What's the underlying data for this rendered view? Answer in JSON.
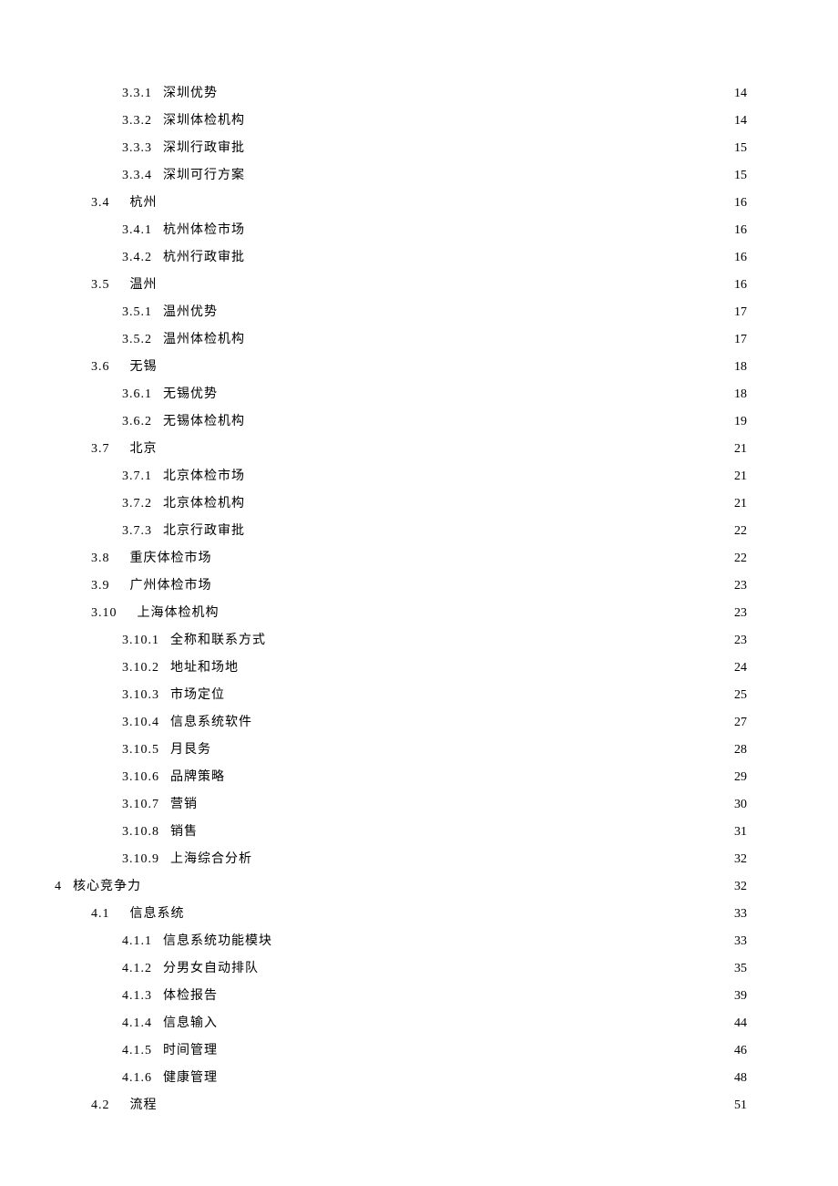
{
  "toc": [
    {
      "indent": 3,
      "num": "3.3.1",
      "title": "深圳优势",
      "page": "14"
    },
    {
      "indent": 3,
      "num": "3.3.2",
      "title": "深圳体检机构",
      "page": "14"
    },
    {
      "indent": 3,
      "num": "3.3.3",
      "title": "深圳行政审批",
      "page": "15"
    },
    {
      "indent": 3,
      "num": "3.3.4",
      "title": "深圳可行方案",
      "page": "15"
    },
    {
      "indent": 2,
      "num": "3.4",
      "title": "杭州",
      "page": "16"
    },
    {
      "indent": 3,
      "num": "3.4.1",
      "title": "杭州体检市场",
      "page": "16"
    },
    {
      "indent": 3,
      "num": "3.4.2",
      "title": "杭州行政审批",
      "page": "16"
    },
    {
      "indent": 2,
      "num": "3.5",
      "title": "温州",
      "page": "16"
    },
    {
      "indent": 3,
      "num": "3.5.1",
      "title": "温州优势",
      "page": "17"
    },
    {
      "indent": 3,
      "num": "3.5.2",
      "title": "温州体检机构",
      "page": "17"
    },
    {
      "indent": 2,
      "num": "3.6",
      "title": "无锡",
      "page": "18"
    },
    {
      "indent": 3,
      "num": "3.6.1",
      "title": "无锡优势",
      "page": "18"
    },
    {
      "indent": 3,
      "num": "3.6.2",
      "title": "无锡体检机构",
      "page": "19"
    },
    {
      "indent": 2,
      "num": "3.7",
      "title": "北京",
      "page": "21"
    },
    {
      "indent": 3,
      "num": "3.7.1",
      "title": "北京体检市场",
      "page": "21"
    },
    {
      "indent": 3,
      "num": "3.7.2",
      "title": "北京体检机构",
      "page": "21"
    },
    {
      "indent": 3,
      "num": "3.7.3",
      "title": "北京行政审批",
      "page": "22"
    },
    {
      "indent": 2,
      "num": "3.8",
      "title": "重庆体检市场",
      "page": "22"
    },
    {
      "indent": 2,
      "num": "3.9",
      "title": "广州体检市场",
      "page": "23"
    },
    {
      "indent": 2,
      "num": "3.10",
      "title": "上海体检机构",
      "page": "23"
    },
    {
      "indent": 3,
      "num": "3.10.1",
      "title": "全称和联系方式",
      "page": "23"
    },
    {
      "indent": 3,
      "num": "3.10.2",
      "title": "地址和场地",
      "page": "24"
    },
    {
      "indent": 3,
      "num": "3.10.3",
      "title": "市场定位",
      "page": "25"
    },
    {
      "indent": 3,
      "num": "3.10.4",
      "title": "信息系统软件",
      "page": "27"
    },
    {
      "indent": 3,
      "num": "3.10.5",
      "title": "月艮务",
      "page": "28"
    },
    {
      "indent": 3,
      "num": "3.10.6",
      "title": "品牌策略",
      "page": "29"
    },
    {
      "indent": 3,
      "num": "3.10.7",
      "title": "营销",
      "page": "30"
    },
    {
      "indent": 3,
      "num": "3.10.8",
      "title": "销售",
      "page": "31"
    },
    {
      "indent": 3,
      "num": "3.10.9",
      "title": "上海综合分析",
      "page": "32"
    },
    {
      "indent": 1,
      "num": "4",
      "title": "核心竞争力",
      "page": "32"
    },
    {
      "indent": 2,
      "num": "4.1",
      "title": "信息系统",
      "page": "33"
    },
    {
      "indent": 3,
      "num": "4.1.1",
      "title": "信息系统功能模块",
      "page": "33"
    },
    {
      "indent": 3,
      "num": "4.1.2",
      "title": "分男女自动排队",
      "page": "35"
    },
    {
      "indent": 3,
      "num": "4.1.3",
      "title": "体检报告",
      "page": "39"
    },
    {
      "indent": 3,
      "num": "4.1.4",
      "title": "信息输入",
      "page": "44"
    },
    {
      "indent": 3,
      "num": "4.1.5",
      "title": "时间管理",
      "page": "46"
    },
    {
      "indent": 3,
      "num": "4.1.6",
      "title": "健康管理",
      "page": "48"
    },
    {
      "indent": 2,
      "num": "4.2",
      "title": "流程",
      "page": "51"
    }
  ]
}
